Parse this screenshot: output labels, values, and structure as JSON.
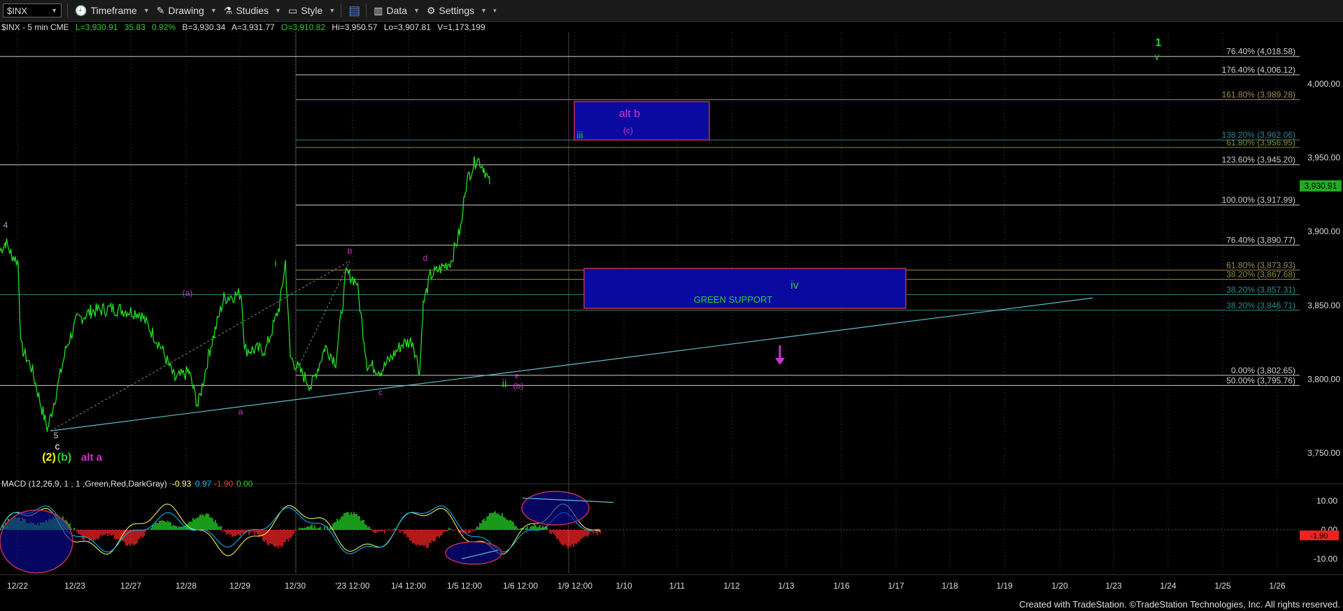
{
  "toolbar": {
    "symbol": "$INX",
    "timeframe": "Timeframe",
    "drawing": "Drawing",
    "studies": "Studies",
    "style": "Style",
    "data": "Data",
    "settings": "Settings"
  },
  "quote": {
    "name": "$INX - 5 min  CME",
    "last": "L=3,930.91",
    "chg": "35.83",
    "pct": "0.92%",
    "bid": "B=3,930.34",
    "ask": "A=3,931.77",
    "open": "O=3,910.82",
    "hi": "Hi=3,950.57",
    "lo": "Lo=3,907.81",
    "vol": "V=1,173,199"
  },
  "footer": "Created with TradeStation. ©TradeStation Technologies, Inc. All rights reserved.",
  "chart_data": [
    {
      "type": "line",
      "title": "",
      "price_axis": [
        "4,000.00",
        "3,950.00",
        "3,900.00",
        "3,850.00",
        "3,800.00",
        "3,750.00"
      ],
      "price_axis_values": [
        4000,
        3950,
        3900,
        3850,
        3800,
        3750
      ],
      "ylim": [
        3733,
        4035
      ],
      "last_price": "3,930.91",
      "x_ticks": [
        "12/22",
        "12/23",
        "12/27",
        "12/28",
        "12/29",
        "12/30",
        "'23 12:00",
        "1/4 12:00",
        "1/5 12:00",
        "1/6 12:00",
        "1/9 12:00",
        "1/10",
        "1/11",
        "1/12",
        "1/13",
        "1/16",
        "1/17",
        "1/18",
        "1/19",
        "1/20",
        "1/23",
        "1/24",
        "1/25",
        "1/26"
      ],
      "price_path": [
        [
          0,
          3887
        ],
        [
          8,
          3893
        ],
        [
          16,
          3885
        ],
        [
          26,
          3879
        ],
        [
          30,
          3822
        ],
        [
          45,
          3808
        ],
        [
          60,
          3780
        ],
        [
          68,
          3766
        ],
        [
          80,
          3790
        ],
        [
          95,
          3822
        ],
        [
          110,
          3840
        ],
        [
          130,
          3846
        ],
        [
          160,
          3848
        ],
        [
          200,
          3845
        ],
        [
          230,
          3822
        ],
        [
          250,
          3800
        ],
        [
          270,
          3805
        ],
        [
          283,
          3782
        ],
        [
          300,
          3820
        ],
        [
          320,
          3855
        ],
        [
          345,
          3858
        ],
        [
          350,
          3820
        ],
        [
          380,
          3820
        ],
        [
          400,
          3850
        ],
        [
          408,
          3880
        ],
        [
          415,
          3815
        ],
        [
          430,
          3805
        ],
        [
          445,
          3795
        ],
        [
          465,
          3822
        ],
        [
          480,
          3812
        ],
        [
          495,
          3872
        ],
        [
          510,
          3866
        ],
        [
          525,
          3810
        ],
        [
          545,
          3806
        ],
        [
          560,
          3815
        ],
        [
          575,
          3824
        ],
        [
          590,
          3826
        ],
        [
          600,
          3805
        ],
        [
          605,
          3850
        ],
        [
          615,
          3870
        ],
        [
          630,
          3875
        ],
        [
          645,
          3880
        ],
        [
          660,
          3905
        ],
        [
          665,
          3930
        ],
        [
          672,
          3940
        ],
        [
          682,
          3950
        ],
        [
          692,
          3943
        ],
        [
          700,
          3932
        ]
      ],
      "fib_levels": [
        {
          "label": "76.40% (4,018.58)",
          "value": 4018.58,
          "color": "#cccccc"
        },
        {
          "label": "176.40% (4,006.12)",
          "value": 4006.12,
          "color": "#cccccc"
        },
        {
          "label": "161.80% (3,989.28)",
          "value": 3989.28,
          "color": "#a08a50"
        },
        {
          "label": "138.20% (3,962.06)",
          "value": 3962.06,
          "color": "#2e8b8b"
        },
        {
          "label": "61.80% (3,956.95)",
          "value": 3956.95,
          "color": "#8a8a40"
        },
        {
          "label": "123.60% (3,945.20)",
          "value": 3945.2,
          "color": "#cccccc"
        },
        {
          "label": "100.00% (3,917.99)",
          "value": 3917.99,
          "color": "#cccccc"
        },
        {
          "label": "76.40% (3,890.77)",
          "value": 3890.77,
          "color": "#cccccc"
        },
        {
          "label": "61.80% (3,873.93)",
          "value": 3873.93,
          "color": "#a08a50"
        },
        {
          "label": "38.20% (3,867.68)",
          "value": 3867.68,
          "color": "#8a8a40"
        },
        {
          "label": "38.20% (3,857.31)",
          "value": 3857.31,
          "color": "#2e8b8b"
        },
        {
          "label": "38.20% (3,846.71)",
          "value": 3846.71,
          "color": "#2e8b8b"
        },
        {
          "label": "0.00% (3,802.65)",
          "value": 3802.65,
          "color": "#cccccc"
        },
        {
          "label": "50.00% (3,795.76)",
          "value": 3795.76,
          "color": "#cccccc"
        }
      ],
      "zones": [
        {
          "label": "alt b",
          "sublabel": "(c)",
          "from": 3962,
          "to": 3988
        },
        {
          "label": "iv",
          "sublabel": "GREEN SUPPORT",
          "from": 3848,
          "to": 3875
        }
      ],
      "wave_labels": [
        {
          "text": "4",
          "color": "#7fb0d0"
        },
        {
          "text": "5",
          "color": "#cccccc"
        },
        {
          "text": "c",
          "color": "#ffffff"
        },
        {
          "text": "(2)",
          "color": "#ffff00"
        },
        {
          "text": "(b)",
          "color": "#33cc33"
        },
        {
          "text": "alt a",
          "color": "#cc33cc"
        },
        {
          "text": "(a)",
          "color": "#cc33cc"
        },
        {
          "text": "a",
          "color": "#cc33cc"
        },
        {
          "text": "i",
          "color": "#33cc33"
        },
        {
          "text": "b",
          "color": "#cc33cc"
        },
        {
          "text": "c",
          "color": "#cc33cc"
        },
        {
          "text": "d",
          "color": "#cc33cc"
        },
        {
          "text": "e",
          "color": "#cc33cc"
        },
        {
          "text": "ii",
          "color": "#33cc33"
        },
        {
          "text": "(b)",
          "color": "#cc33cc"
        },
        {
          "text": "iii",
          "color": "#33cc33"
        },
        {
          "text": "1",
          "color": "#33cc33"
        },
        {
          "text": "v",
          "color": "#33cc33"
        }
      ]
    },
    {
      "type": "line",
      "title": "MACD (12,26,9, 1 , 1 ,Green,Red,DarkGray)",
      "values": [
        "-0.93",
        "0.97",
        "-1.90",
        "0.00"
      ],
      "value_colors": [
        "#ffff66",
        "#00bfff",
        "#ff3333",
        "#33cc33"
      ],
      "axis": [
        "10.00",
        "0.00",
        "-10.00"
      ],
      "axis_values": [
        10,
        0,
        -10
      ],
      "ylim": [
        -15,
        14
      ],
      "last_value": "-1.90"
    }
  ]
}
